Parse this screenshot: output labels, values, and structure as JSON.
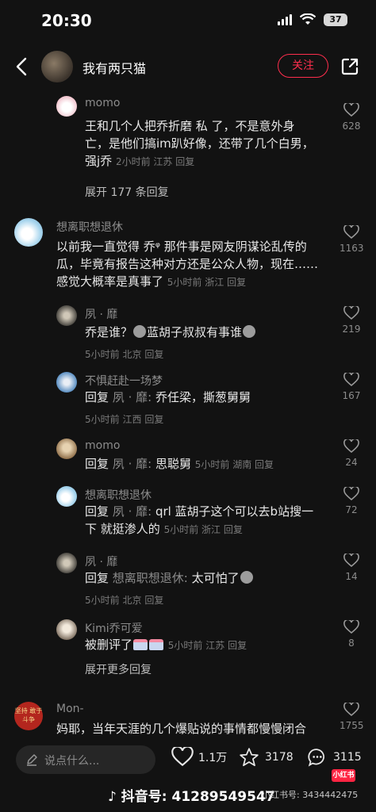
{
  "status": {
    "time": "20:30",
    "battery": "37"
  },
  "nav": {
    "title": "我有两只猫",
    "follow_label": "关注"
  },
  "comments": [
    {
      "name": "momo",
      "text": "王和几个人把乔折磨 私 了，不是意外身亡，是他们搞im趴好像，还带了几个白男，强j乔",
      "time": "2小时前",
      "location": "江苏",
      "reply": "回复",
      "likes": "628",
      "expand": "展开 177 条回复"
    },
    {
      "name": "想离职想退休",
      "text": "以前我一直觉得 乔ᵠ 那件事是网友阴谋论乱传的瓜，毕竟有报告这种对方还是公众人物，现在……感觉大概率是真事了",
      "time": "5小时前",
      "location": "浙江",
      "reply": "回复",
      "likes": "1163"
    }
  ],
  "replies": [
    {
      "name": "夙 · 靡",
      "text": "乔是谁？",
      "text2": "蓝胡子叔叔有事谁",
      "time": "5小时前",
      "location": "北京",
      "reply": "回复",
      "likes": "219"
    },
    {
      "name": "不惧赶赴一场梦",
      "prefix": "回复",
      "target": "夙 · 靡:",
      "text": "乔任梁，撕葱舅舅",
      "time": "5小时前",
      "location": "江西",
      "reply": "回复",
      "likes": "167"
    },
    {
      "name": "momo",
      "prefix": "回复",
      "target": "夙 · 靡:",
      "text": "思聪舅",
      "time": "5小时前",
      "location": "湖南",
      "reply": "回复",
      "likes": "24"
    },
    {
      "name": "想离职想退休",
      "prefix": "回复",
      "target": "夙 · 靡:",
      "text": "qrl 蓝胡子这个可以去b站搜一下 就挺渗人的",
      "time": "5小时前",
      "location": "浙江",
      "reply": "回复",
      "likes": "72"
    },
    {
      "name": "夙 · 靡",
      "prefix": "回复",
      "target": "想离职想退休:",
      "text": "太可怕了",
      "time": "5小时前",
      "location": "北京",
      "reply": "回复",
      "likes": "14"
    },
    {
      "name": "Kimi乔可爱",
      "text": "被删评了",
      "time": "5小时前",
      "location": "江苏",
      "reply": "回复",
      "likes": "8"
    }
  ],
  "expand_more": "展开更多回复",
  "last_comment": {
    "name": "Mon-",
    "text": "妈耶，当年天涯的几个爆贴说的事情都慢慢闭合",
    "likes": "1755",
    "avatar_text": "坚持 敢于斗争"
  },
  "bottom": {
    "placeholder": "说点什么...",
    "likes": "1.1万",
    "stars": "3178",
    "comments": "3115"
  },
  "watermark": {
    "tiktok": "抖音号: 41289549547",
    "xhs_id": "小红书号: 3434442475",
    "xhs_logo": "小红书"
  },
  "colors": {
    "accent": "#ff2e4d",
    "background": "#121212"
  }
}
